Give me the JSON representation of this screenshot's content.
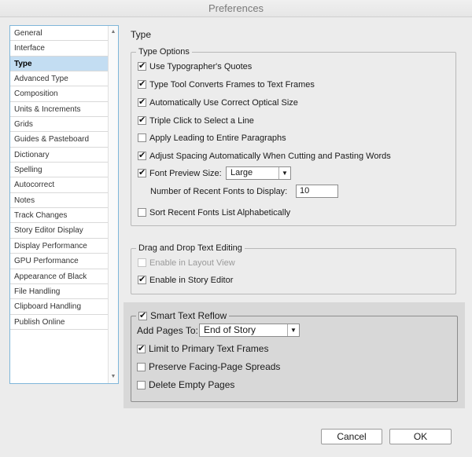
{
  "window": {
    "title": "Preferences"
  },
  "sidebar": {
    "items": [
      {
        "label": "General"
      },
      {
        "label": "Interface"
      },
      {
        "label": "Type",
        "selected": true
      },
      {
        "label": "Advanced Type"
      },
      {
        "label": "Composition"
      },
      {
        "label": "Units & Increments"
      },
      {
        "label": "Grids"
      },
      {
        "label": "Guides & Pasteboard"
      },
      {
        "label": "Dictionary"
      },
      {
        "label": "Spelling"
      },
      {
        "label": "Autocorrect"
      },
      {
        "label": "Notes"
      },
      {
        "label": "Track Changes"
      },
      {
        "label": "Story Editor Display"
      },
      {
        "label": "Display Performance"
      },
      {
        "label": "GPU Performance"
      },
      {
        "label": "Appearance of Black"
      },
      {
        "label": "File Handling"
      },
      {
        "label": "Clipboard Handling"
      },
      {
        "label": "Publish Online"
      }
    ]
  },
  "main": {
    "title": "Type",
    "type_options": {
      "legend": "Type Options",
      "options": [
        {
          "label": "Use Typographer's Quotes",
          "checked": true
        },
        {
          "label": "Type Tool Converts Frames to Text Frames",
          "checked": true
        },
        {
          "label": "Automatically Use Correct Optical Size",
          "checked": true
        },
        {
          "label": "Triple Click to Select a Line",
          "checked": true
        },
        {
          "label": "Apply Leading to Entire Paragraphs",
          "checked": false
        },
        {
          "label": "Adjust Spacing Automatically When Cutting and Pasting Words",
          "checked": true
        },
        {
          "label": "Font Preview Size:",
          "checked": true
        }
      ],
      "font_preview_size": "Large",
      "recent_fonts_label": "Number of Recent Fonts to Display:",
      "recent_fonts_value": "10",
      "sort_recent": {
        "label": "Sort Recent Fonts List Alphabetically",
        "checked": false
      }
    },
    "drag_drop": {
      "legend": "Drag and Drop Text Editing",
      "options": [
        {
          "label": "Enable in Layout View",
          "checked": false,
          "disabled": true
        },
        {
          "label": "Enable in Story Editor",
          "checked": true
        }
      ]
    },
    "smart_reflow": {
      "legend": "Smart Text Reflow",
      "checked": true,
      "add_pages_label": "Add Pages To:",
      "add_pages_value": "End of Story",
      "options": [
        {
          "label": "Limit to Primary Text Frames",
          "checked": true
        },
        {
          "label": "Preserve Facing-Page Spreads",
          "checked": false
        },
        {
          "label": "Delete Empty Pages",
          "checked": false
        }
      ]
    }
  },
  "footer": {
    "cancel_label": "Cancel",
    "ok_label": "OK"
  }
}
